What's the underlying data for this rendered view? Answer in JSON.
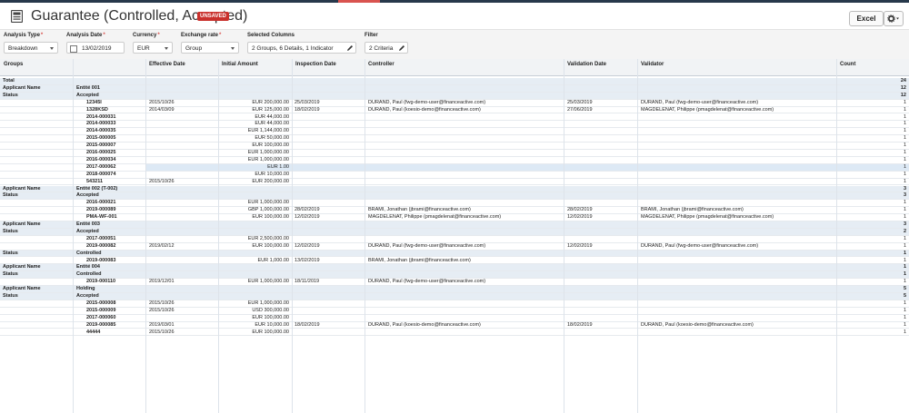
{
  "app": {
    "title": "Guarantee (Controlled, Accepted)",
    "badge": "UNSAVED",
    "excel_label": "Excel"
  },
  "filters": {
    "analysis_type": {
      "label": "Analysis Type",
      "value": "Breakdown"
    },
    "analysis_date": {
      "label": "Analysis Date",
      "value": "13/02/2019"
    },
    "currency": {
      "label": "Currency",
      "value": "EUR"
    },
    "exchange_rate": {
      "label": "Exchange rate",
      "value": "Group"
    },
    "selected_columns": {
      "label": "Selected Columns",
      "value": "2 Groups, 6 Details, 1 Indicator"
    },
    "filter": {
      "label": "Filter",
      "value": "2 Criteria"
    }
  },
  "columns": {
    "groups": "Groups",
    "effective_date": "Effective Date",
    "initial_amount": "Initial Amount",
    "inspection_date": "Inspection Date",
    "controller": "Controller",
    "validation_date": "Validation Date",
    "validator": "Validator",
    "count": "Count"
  },
  "colors": {
    "accent": "#c9302c",
    "group_row": "#e6edf4",
    "selected_row": "#dde9f5"
  },
  "rows": [
    {
      "type": "group",
      "c0": "Total",
      "c1": "",
      "eff": "",
      "amt": "",
      "insp": "",
      "ctrl": "",
      "val": "",
      "valr": "",
      "count": "24"
    },
    {
      "type": "group",
      "c0": "Applicant Name",
      "c1": "Entité 001",
      "eff": "",
      "amt": "",
      "insp": "",
      "ctrl": "",
      "val": "",
      "valr": "",
      "count": "12"
    },
    {
      "type": "group",
      "c0": "Status",
      "c1": "Accepted",
      "eff": "",
      "amt": "",
      "insp": "",
      "ctrl": "",
      "val": "",
      "valr": "",
      "count": "12"
    },
    {
      "type": "detail",
      "id": "12345I",
      "eff": "2015/10/26",
      "amt": "EUR 200,000.00",
      "insp": "25/03/2019",
      "ctrl": "DURAND, Paul (fwg-demo-user@financeactive.com)",
      "val": "25/03/2019",
      "valr": "DURAND, Paul (fwg-demo-user@financeactive.com)",
      "count": "1"
    },
    {
      "type": "detail",
      "id": "1328KSD",
      "eff": "2014/03/09",
      "amt": "EUR 125,000.00",
      "insp": "18/02/2019",
      "ctrl": "DURAND, Paul (koesio-demo@financeactive.com)",
      "val": "27/06/2019",
      "valr": "MAGDELENAT, Philippe (pmagdelenat@financeactive.com)",
      "count": "1"
    },
    {
      "type": "detail",
      "id": "2014-000031",
      "eff": "",
      "amt": "EUR 44,000.00",
      "insp": "",
      "ctrl": "",
      "val": "",
      "valr": "",
      "count": "1"
    },
    {
      "type": "detail",
      "id": "2014-000033",
      "eff": "",
      "amt": "EUR 44,000.00",
      "insp": "",
      "ctrl": "",
      "val": "",
      "valr": "",
      "count": "1"
    },
    {
      "type": "detail",
      "id": "2014-000035",
      "eff": "",
      "amt": "EUR 1,144,000.00",
      "insp": "",
      "ctrl": "",
      "val": "",
      "valr": "",
      "count": "1"
    },
    {
      "type": "detail",
      "id": "2015-000005",
      "eff": "",
      "amt": "EUR 50,000.00",
      "insp": "",
      "ctrl": "",
      "val": "",
      "valr": "",
      "count": "1"
    },
    {
      "type": "detail",
      "id": "2015-000007",
      "eff": "",
      "amt": "EUR 100,000.00",
      "insp": "",
      "ctrl": "",
      "val": "",
      "valr": "",
      "count": "1"
    },
    {
      "type": "detail",
      "id": "2016-000025",
      "eff": "",
      "amt": "EUR 1,000,000.00",
      "insp": "",
      "ctrl": "",
      "val": "",
      "valr": "",
      "count": "1"
    },
    {
      "type": "detail",
      "id": "2016-000034",
      "eff": "",
      "amt": "EUR 1,000,000.00",
      "insp": "",
      "ctrl": "",
      "val": "",
      "valr": "",
      "count": "1"
    },
    {
      "type": "selected",
      "id": "2017-000062",
      "eff": "",
      "amt": "EUR 1.00",
      "insp": "",
      "ctrl": "",
      "val": "",
      "valr": "",
      "count": "1"
    },
    {
      "type": "detail",
      "id": "2018-000074",
      "eff": "",
      "amt": "EUR 10,000.00",
      "insp": "",
      "ctrl": "",
      "val": "",
      "valr": "",
      "count": "1"
    },
    {
      "type": "detail",
      "id": "543211",
      "eff": "2015/10/26",
      "amt": "EUR 200,000.00",
      "insp": "",
      "ctrl": "",
      "val": "",
      "valr": "",
      "count": "1"
    },
    {
      "type": "group",
      "c0": "Applicant Name",
      "c1": "Entité 002 (T-002)",
      "eff": "",
      "amt": "",
      "insp": "",
      "ctrl": "",
      "val": "",
      "valr": "",
      "count": "3"
    },
    {
      "type": "group",
      "c0": "Status",
      "c1": "Accepted",
      "eff": "",
      "amt": "",
      "insp": "",
      "ctrl": "",
      "val": "",
      "valr": "",
      "count": "3"
    },
    {
      "type": "detail",
      "id": "2016-000021",
      "eff": "",
      "amt": "EUR 1,000,000.00",
      "insp": "",
      "ctrl": "",
      "val": "",
      "valr": "",
      "count": "1"
    },
    {
      "type": "detail",
      "id": "2019-000089",
      "eff": "",
      "amt": "GBP 1,000,000.00",
      "insp": "28/02/2019",
      "ctrl": "BRAMI, Jonathan (jbrami@financeactive.com)",
      "val": "28/02/2019",
      "valr": "BRAMI, Jonathan (jbrami@financeactive.com)",
      "count": "1"
    },
    {
      "type": "detail",
      "id": "PMA-WF-001",
      "eff": "",
      "amt": "EUR 100,000.00",
      "insp": "12/02/2019",
      "ctrl": "MAGDELENAT, Philippe (pmagdelenat@financeactive.com)",
      "val": "12/02/2019",
      "valr": "MAGDELENAT, Philippe (pmagdelenat@financeactive.com)",
      "count": "1"
    },
    {
      "type": "group",
      "c0": "Applicant Name",
      "c1": "Entité 003",
      "eff": "",
      "amt": "",
      "insp": "",
      "ctrl": "",
      "val": "",
      "valr": "",
      "count": "3"
    },
    {
      "type": "group",
      "c0": "Status",
      "c1": "Accepted",
      "eff": "",
      "amt": "",
      "insp": "",
      "ctrl": "",
      "val": "",
      "valr": "",
      "count": "2"
    },
    {
      "type": "detail",
      "id": "2017-000051",
      "eff": "",
      "amt": "EUR 2,500,000.00",
      "insp": "",
      "ctrl": "",
      "val": "",
      "valr": "",
      "count": "1"
    },
    {
      "type": "detail",
      "id": "2019-000082",
      "eff": "2019/02/12",
      "amt": "EUR 100,000.00",
      "insp": "12/02/2019",
      "ctrl": "DURAND, Paul (fwg-demo-user@financeactive.com)",
      "val": "12/02/2019",
      "valr": "DURAND, Paul (fwg-demo-user@financeactive.com)",
      "count": "1"
    },
    {
      "type": "group",
      "c0": "Status",
      "c1": "Controlled",
      "eff": "",
      "amt": "",
      "insp": "",
      "ctrl": "",
      "val": "",
      "valr": "",
      "count": "1"
    },
    {
      "type": "detail",
      "id": "2019-000083",
      "eff": "",
      "amt": "EUR 1,000.00",
      "insp": "13/02/2019",
      "ctrl": "BRAMI, Jonathan (jbrami@financeactive.com)",
      "val": "",
      "valr": "",
      "count": "1"
    },
    {
      "type": "group",
      "c0": "Applicant Name",
      "c1": "Entité 004",
      "eff": "",
      "amt": "",
      "insp": "",
      "ctrl": "",
      "val": "",
      "valr": "",
      "count": "1"
    },
    {
      "type": "group",
      "c0": "Status",
      "c1": "Controlled",
      "eff": "",
      "amt": "",
      "insp": "",
      "ctrl": "",
      "val": "",
      "valr": "",
      "count": "1"
    },
    {
      "type": "detail",
      "id": "2019-000110",
      "eff": "2019/12/01",
      "amt": "EUR 1,000,000.00",
      "insp": "18/11/2019",
      "ctrl": "DURAND, Paul (fwg-demo-user@financeactive.com)",
      "val": "",
      "valr": "",
      "count": "1"
    },
    {
      "type": "group",
      "c0": "Applicant Name",
      "c1": "Holding",
      "eff": "",
      "amt": "",
      "insp": "",
      "ctrl": "",
      "val": "",
      "valr": "",
      "count": "5"
    },
    {
      "type": "group",
      "c0": "Status",
      "c1": "Accepted",
      "eff": "",
      "amt": "",
      "insp": "",
      "ctrl": "",
      "val": "",
      "valr": "",
      "count": "5"
    },
    {
      "type": "detail",
      "id": "2015-000008",
      "eff": "2015/10/26",
      "amt": "EUR 1,000,000.00",
      "insp": "",
      "ctrl": "",
      "val": "",
      "valr": "",
      "count": "1"
    },
    {
      "type": "detail",
      "id": "2015-000009",
      "eff": "2015/10/26",
      "amt": "USD 300,000.00",
      "insp": "",
      "ctrl": "",
      "val": "",
      "valr": "",
      "count": "1"
    },
    {
      "type": "detail",
      "id": "2017-000060",
      "eff": "",
      "amt": "EUR 100,000.00",
      "insp": "",
      "ctrl": "",
      "val": "",
      "valr": "",
      "count": "1"
    },
    {
      "type": "detail",
      "id": "2019-000085",
      "eff": "2019/03/01",
      "amt": "EUR 10,000.00",
      "insp": "18/02/2019",
      "ctrl": "DURAND, Paul (koesio-demo@financeactive.com)",
      "val": "18/02/2019",
      "valr": "DURAND, Paul (koesio-demo@financeactive.com)",
      "count": "1"
    },
    {
      "type": "detail",
      "id": "44444",
      "eff": "2015/10/26",
      "amt": "EUR 100,000.00",
      "insp": "",
      "ctrl": "",
      "val": "",
      "valr": "",
      "count": "1"
    }
  ]
}
